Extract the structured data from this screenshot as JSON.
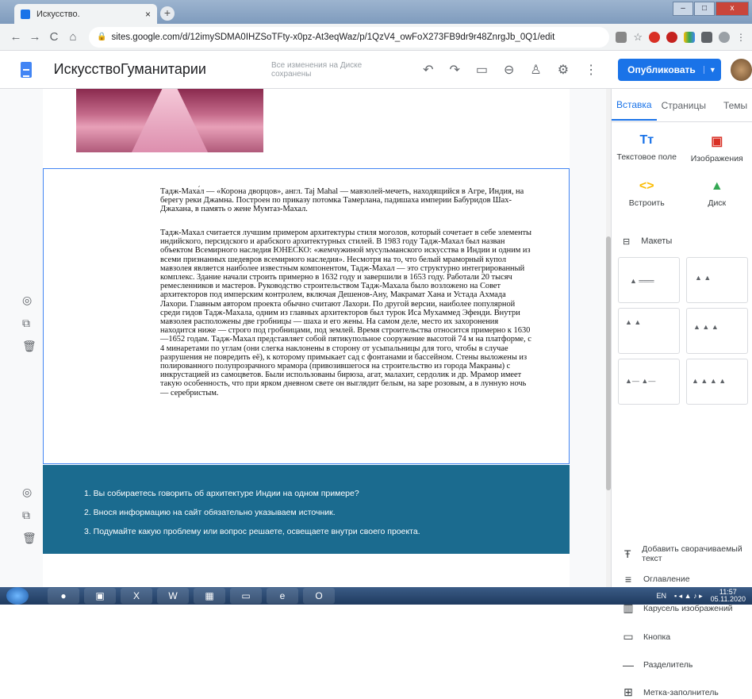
{
  "browser": {
    "tab_title": "Искусство.",
    "tab_close": "×",
    "newtab": "+",
    "url": "sites.google.com/d/12imySDMA0IHZSoTFty-x0pz-At3eqWaz/p/1QzV4_owFoX273FB9dr9r48ZnrgJb_0Q1/edit",
    "win_min": "–",
    "win_max": "□",
    "win_close": "x"
  },
  "header": {
    "site_name": "ИскусствоГуманитарии",
    "saved_status": "Все изменения на Диске сохранены",
    "publish_label": "Опубликовать"
  },
  "content": {
    "paragraph1": "Тадж-Маха́л — «Корона дворцов», англ. Taj Mahal — мавзолей-мечеть, находящийся в Агре, Индия, на берегу реки Джамна. Построен по приказу потомка Тамерлана, падишаха империи Бабуридов Шах-Джахана, в память о жене Мумтаз-Махал.",
    "paragraph2": "Тадж-Махал считается лучшим примером архитектуры стиля моголов, который сочетает в себе элементы индийского, персидского и арабского архитектурных стилей. В 1983 году Тадж-Махал был назван объектом Всемирного наследия ЮНЕСКО: «жемчужиной мусульманского искусства в Индии и одним из всеми признанных шедевров всемирного наследия». Несмотря на то, что белый мраморный купол мавзолея является наиболее известным компонентом, Тадж-Махал — это структурно интегрированный комплекс. Здание начали строить примерно в 1632 году и завершили в 1653 году. Работали 20 тысяч ремесленников и мастеров. Руководство строительством Тадж-Махала было возложено на Совет архитекторов под имперским контролем, включая Дешенов-Ану, Макрамат Хана и Устада Ахмада Лахори. Главным автором проекта обычно считают Лахори. По другой версии, наиболее популярной среди гидов Тадж-Махала, одним из главных архитекторов был турок Иса Мухаммед Эфенди. Внутри мавзолея расположены две гробницы — шаха и его жены. На самом деле, место их захоронения находится ниже — строго под гробницами, под землей. Время строительства относится примерно к 1630—1652 годам. Тадж-Махал представляет собой пятикупольное сооружение высотой 74 м на платформе, с 4 минаретами по углам (они слегка наклонены в сторону от усыпальницы для того, чтобы в случае разрушения не повредить её), к которому примыкает сад с фонтанами и бассейном. Стены выложены из полированного полупрозрачного мрамора (привозившегося на строительство из города Макраны) с инкрустацией из самоцветов. Были использованы бирюза, агат, малахит, сердолик и др. Мрамор имеет такую особенность, что при ярком дневном свете он выглядит белым, на заре розовым, а в лунную ночь — серебристым.",
    "questions": [
      "1. Вы собираетесь говорить об архитектуре Индии на одном примере?",
      "2. Внося информацию на сайт обязательно указываем источник.",
      "3. Подумайте какую проблему или вопрос решаете, освещаете внутри своего проекта."
    ]
  },
  "panel": {
    "tabs": [
      "Вставка",
      "Страницы",
      "Темы"
    ],
    "insert_items": [
      {
        "glyph": "Tт",
        "label": "Текстовое поле"
      },
      {
        "glyph": "▣",
        "label": "Изображения"
      },
      {
        "glyph": "<>",
        "label": "Встроить"
      },
      {
        "glyph": "▲",
        "label": "Диск"
      }
    ],
    "layouts_label": "Макеты",
    "list_items": [
      {
        "glyph": "Ŧ",
        "label": "Добавить сворачиваемый текст"
      },
      {
        "glyph": "≡",
        "label": "Оглавление"
      },
      {
        "glyph": "▥",
        "label": "Карусель изображений"
      },
      {
        "glyph": "▭",
        "label": "Кнопка"
      },
      {
        "glyph": "—",
        "label": "Разделитель"
      },
      {
        "glyph": "⊞",
        "label": "Метка-заполнитель"
      }
    ]
  },
  "taskbar": {
    "lang": "EN",
    "time": "11:57",
    "date": "05.11.2020"
  },
  "colors": {
    "accent": "#1a73e8",
    "dark_block": "#1b6b8f"
  }
}
